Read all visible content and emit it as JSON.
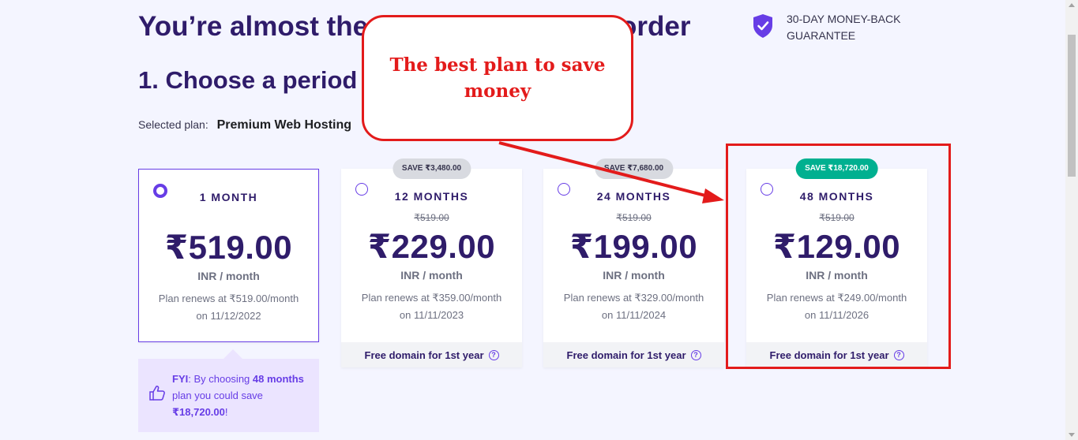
{
  "header": {
    "title_visible_start": "You’re almost the",
    "title_visible_end": "order",
    "step_title": "1. Choose a period"
  },
  "guarantee": {
    "text": "30-DAY MONEY-BACK GUARANTEE",
    "icon": "shield-check-icon"
  },
  "selected_plan": {
    "label": "Selected plan:",
    "value": "Premium Web Hosting"
  },
  "plans": [
    {
      "period": "1 MONTH",
      "old_price": "",
      "price": "₹519.00",
      "unit": "INR / month",
      "renew": "Plan renews at ₹519.00/month",
      "renew_date": "on 11/12/2022",
      "save": "",
      "footer": "",
      "checked": true
    },
    {
      "period": "12 MONTHS",
      "old_price": "₹519.00",
      "price": "₹229.00",
      "unit": "INR / month",
      "renew": "Plan renews at ₹359.00/month",
      "renew_date": "on 11/11/2023",
      "save": "SAVE ₹3,480.00",
      "footer": "Free domain for 1st year",
      "checked": false
    },
    {
      "period": "24 MONTHS",
      "old_price": "₹519.00",
      "price": "₹199.00",
      "unit": "INR / month",
      "renew": "Plan renews at ₹329.00/month",
      "renew_date": "on 11/11/2024",
      "save": "SAVE ₹7,680.00",
      "footer": "Free domain for 1st year",
      "checked": false
    },
    {
      "period": "48 MONTHS",
      "old_price": "₹519.00",
      "price": "₹129.00",
      "unit": "INR / month",
      "renew": "Plan renews at ₹249.00/month",
      "renew_date": "on 11/11/2026",
      "save": "SAVE ₹18,720.00",
      "footer": "Free domain for 1st year",
      "checked": false
    }
  ],
  "fyi": {
    "prefix": "FYI",
    "text1": ": By choosing ",
    "bold1": "48 months",
    "text2": " plan you could save ",
    "bold2": "₹18,720.00",
    "text3": "!"
  },
  "annotation": {
    "callout_text": "The best plan to save money",
    "color": "#e31b1b"
  },
  "colors": {
    "primary": "#673de6",
    "heading": "#2f1c6a",
    "save_green": "#00b090",
    "background": "#f4f5ff"
  }
}
